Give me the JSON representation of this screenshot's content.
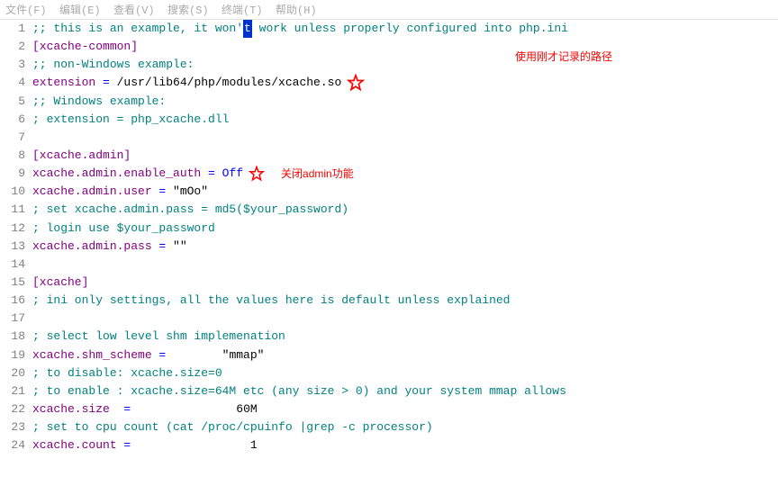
{
  "menubar": "文件(F)  编辑(E)  查看(V)  搜索(S)  终端(T)  帮助(H)",
  "annotations": {
    "path": "使用刚才记录的路径",
    "admin": "关闭admin功能"
  },
  "code": {
    "l1_pre": ";; this is an example, it won'",
    "l1_hlchar": "t",
    "l1_post": " work unless properly configured into php.ini",
    "l2": "[xcache-common]",
    "l3": ";; non-Windows example:",
    "l4_key": "extension",
    "l4_eq": " = ",
    "l4_val": "/usr/lib64/php/modules/xcache.so",
    "l5": ";; Windows example:",
    "l6": "; extension = php_xcache.dll",
    "l7": "",
    "l8": "[xcache.admin]",
    "l9_key": "xcache.admin.enable_auth",
    "l9_eq": " = ",
    "l9_val": "Off",
    "l10_key": "xcache.admin.user",
    "l10_eq": " = ",
    "l10_val": "\"mOo\"",
    "l11": "; set xcache.admin.pass = md5($your_password)",
    "l12": "; login use $your_password",
    "l13_key": "xcache.admin.pass",
    "l13_eq": " = ",
    "l13_val": "\"\"",
    "l14": "",
    "l15": "[xcache]",
    "l16": "; ini only settings, all the values here is default unless explained",
    "l17": "",
    "l18": "; select low level shm implemenation",
    "l19_key": "xcache.shm_scheme",
    "l19_eq": " =        ",
    "l19_val": "\"mmap\"",
    "l20": "; to disable: xcache.size=0",
    "l21": "; to enable : xcache.size=64M etc (any size > 0) and your system mmap allows",
    "l22_key": "xcache.size",
    "l22_eq": "  =               ",
    "l22_val": "60M",
    "l23": "; set to cpu count (cat /proc/cpuinfo |grep -c processor)",
    "l24_key": "xcache.count",
    "l24_eq": " =                 ",
    "l24_val": "1"
  }
}
